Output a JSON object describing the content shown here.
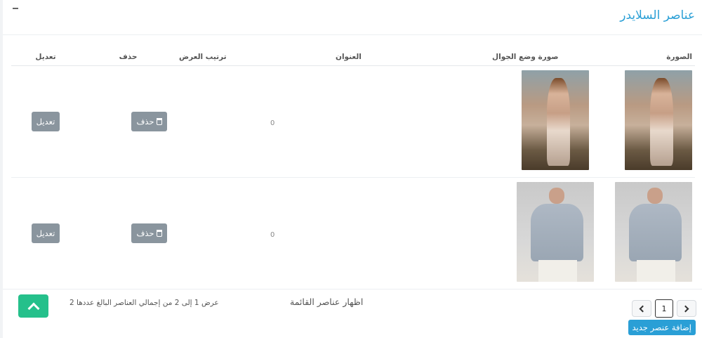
{
  "panel": {
    "title": "عناصر السلايدر"
  },
  "table": {
    "headers": {
      "image": "الصورة",
      "mobile_image": "صورة وضع الجوال",
      "title": "العنوان",
      "order": "ترتيب العرض",
      "delete": "حذف",
      "edit": "تعديل"
    },
    "rows": [
      {
        "title": "",
        "order": "0",
        "delete_label": "حذف",
        "edit_label": "تعديل"
      },
      {
        "title": "",
        "order": "0",
        "delete_label": "حذف",
        "edit_label": "تعديل"
      }
    ]
  },
  "footer": {
    "list_label": "اظهار عناصر القائمة",
    "summary": "عرض 1 إلى 2 من إجمالي العناصر البالغ عددها 2",
    "page_number": "1",
    "add_button": "إضافة عنصر جديد"
  },
  "colors": {
    "accent": "#2a9fd6",
    "scroll_top": "#25c08b",
    "action_button": "#8a959e"
  }
}
